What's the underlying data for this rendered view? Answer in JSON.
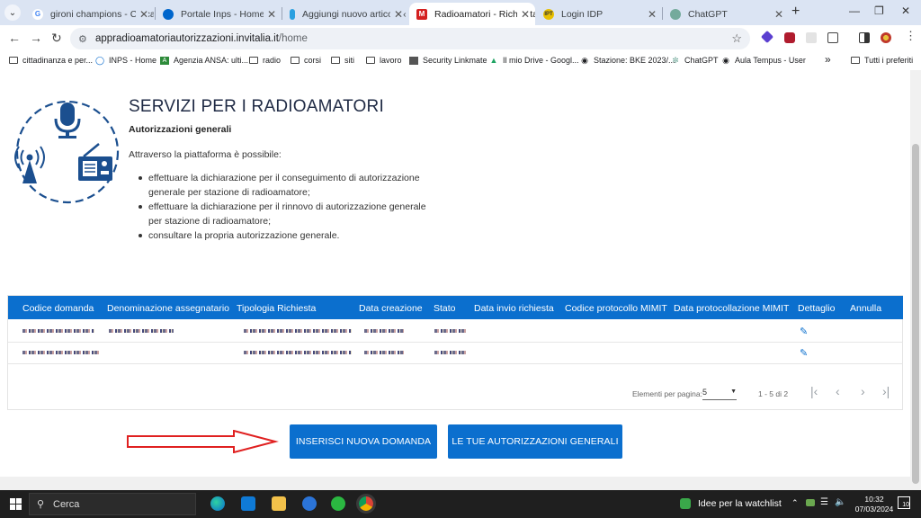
{
  "browser": {
    "tabs": [
      {
        "title": "gironi champions - Cerca c",
        "fav": "G",
        "fav_color": "#ffffff"
      },
      {
        "title": "Portale Inps - Home",
        "fav": "",
        "fav_color": "#0066cc"
      },
      {
        "title": "Aggiungi nuovo articolo ‹ d",
        "fav": "",
        "fav_color": "#2aa0e0"
      },
      {
        "title": "Radioamatori - Richiesta A",
        "fav": "M",
        "fav_color": "#d42020"
      },
      {
        "title": "Login IDP",
        "fav": "IPT",
        "fav_color": "#e8c000"
      },
      {
        "title": "ChatGPT",
        "fav": "",
        "fav_color": "#74aa9c"
      }
    ],
    "new_tab": "+",
    "url_host": "appradioamatoriautorizzazioni.invitalia.it",
    "url_path": "/home",
    "bookmarks": [
      {
        "label": "cittadinanza e  per...",
        "kind": "folder"
      },
      {
        "label": "INPS - Home",
        "kind": "site"
      },
      {
        "label": "Agenzia ANSA: ulti...",
        "kind": "site"
      },
      {
        "label": "radio",
        "kind": "folder"
      },
      {
        "label": "corsi",
        "kind": "folder"
      },
      {
        "label": "siti",
        "kind": "folder"
      },
      {
        "label": "lavoro",
        "kind": "folder"
      },
      {
        "label": "Security Linkmate",
        "kind": "site"
      },
      {
        "label": "Il mio Drive - Googl...",
        "kind": "site"
      },
      {
        "label": "Stazione: BKE 2023/...",
        "kind": "site"
      },
      {
        "label": "ChatGPT",
        "kind": "site"
      },
      {
        "label": "Aula Tempus - User",
        "kind": "site"
      }
    ],
    "bookmarks_more": "»",
    "all_bookmarks": "Tutti i preferiti"
  },
  "page": {
    "title": "SERVIZI PER I RADIOAMATORI",
    "subtitle": "Autorizzazioni generali",
    "intro": "Attraverso la piattaforma è possibile:",
    "bullets": [
      "effettuare la dichiarazione per il conseguimento di autorizzazione generale per stazione di radioamatore;",
      "effettuare la dichiarazione per il rinnovo di autorizzazione generale per stazione di radioamatore;",
      "consultare la propria autorizzazione generale."
    ],
    "table": {
      "columns": [
        "Codice domanda",
        "Denominazione assegnatario",
        "Tipologia Richiesta",
        "Data creazione",
        "Stato",
        "Data invio richiesta",
        "Codice protocollo MIMIT",
        "Data protocollazione MIMIT",
        "Dettaglio",
        "Annulla"
      ],
      "items_per_page_label": "Elementi per pagina:",
      "items_per_page": "5",
      "range": "1 - 5 di 2"
    },
    "buttons": {
      "new_request": "INSERISCI NUOVA DOMANDA",
      "my_authorizations": "LE TUE AUTORIZZAZIONI GENERALI"
    },
    "colors": {
      "primary": "#0b6fce",
      "title": "#1f2a44",
      "arrow": "#e02020"
    }
  },
  "taskbar": {
    "search": "Cerca",
    "watchlist": "Idee per la watchlist",
    "time": "10:32",
    "date": "07/03/2024",
    "notifications": "10"
  }
}
